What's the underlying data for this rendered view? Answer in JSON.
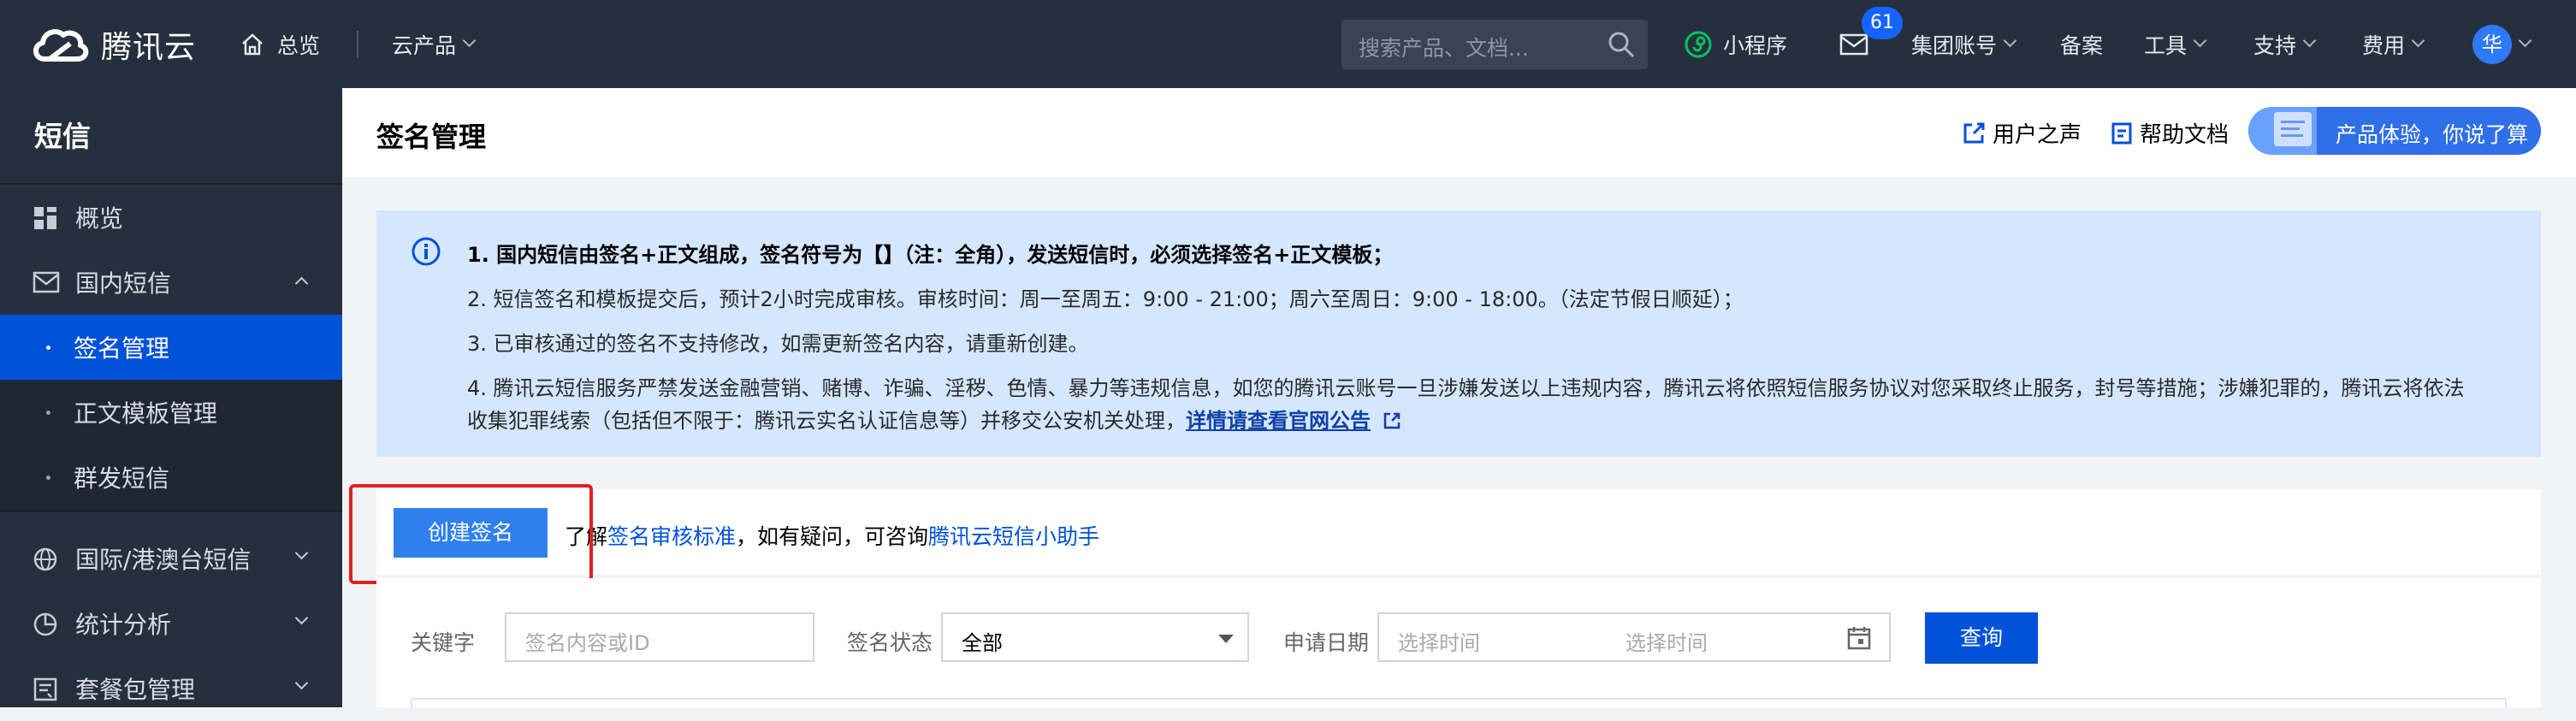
{
  "topnav": {
    "brand": "腾讯云",
    "overview": "总览",
    "products": "云产品",
    "search_placeholder": "搜索产品、文档...",
    "miniapp": "小程序",
    "mail_badge": "61",
    "group_account": "集团账号",
    "beian": "备案",
    "tools": "工具",
    "support": "支持",
    "fees": "费用",
    "avatar": "华"
  },
  "sidebar": {
    "title": "短信",
    "items": [
      {
        "label": "概览"
      },
      {
        "label": "国内短信"
      },
      {
        "label": "签名管理"
      },
      {
        "label": "正文模板管理"
      },
      {
        "label": "群发短信"
      },
      {
        "label": "国际/港澳台短信"
      },
      {
        "label": "统计分析"
      },
      {
        "label": "套餐包管理"
      }
    ]
  },
  "header": {
    "title": "签名管理",
    "user_voice": "用户之声",
    "help_docs": "帮助文档",
    "promo": "产品体验，你说了算"
  },
  "notice": {
    "line1": "1. 国内短信由签名+正文组成，签名符号为【】（注：全角），发送短信时，必须选择签名+正文模板；",
    "line2": "2. 短信签名和模板提交后，预计2小时完成审核。审核时间：周一至周五：9:00 - 21:00；周六至周日：9:00 - 18:00。（法定节假日顺延）；",
    "line3": "3. 已审核通过的签名不支持修改，如需更新签名内容，请重新创建。",
    "line4": "4. 腾讯云短信服务严禁发送金融营销、赌博、诈骗、淫秽、色情、暴力等违规信息，如您的腾讯云账号一旦涉嫌发送以上违规内容，腾讯云将依照短信服务协议对您采取终止服务，封号等措施；涉嫌犯罪的，腾讯云将依法",
    "line5": "收集犯罪线索（包括但不限于：腾讯云实名认证信息等）并移交公安机关处理，",
    "link": "详情请查看官网公告"
  },
  "actions": {
    "create_button": "创建签名",
    "text_prefix": "了解",
    "review_link": "签名审核标准",
    "text_mid": "，如有疑问，可咨询",
    "assistant_link": "腾讯云短信小助手"
  },
  "filter": {
    "keyword_label": "关键字",
    "keyword_placeholder": "签名内容或ID",
    "status_label": "签名状态",
    "status_value": "全部",
    "date_label": "申请日期",
    "date_start_placeholder": "选择时间",
    "date_end_placeholder": "选择时间",
    "query_button": "查询"
  }
}
